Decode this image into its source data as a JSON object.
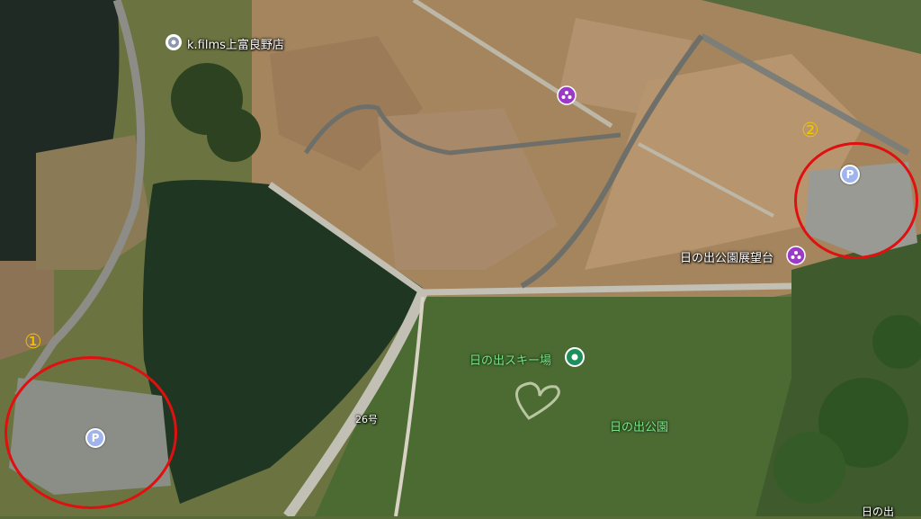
{
  "places": {
    "kfilms": {
      "name": "k.films上富良野店",
      "icon": "location-pin-icon"
    },
    "viewpoint_top": {
      "icon": "viewpoint-icon",
      "color": "#9b39c8"
    },
    "observatory": {
      "name": "日の出公園展望台",
      "icon": "viewpoint-icon",
      "color": "#9b39c8"
    },
    "ski": {
      "name": "日の出スキー場",
      "icon": "ski-pin-icon",
      "color": "#1e8e5a"
    },
    "park": {
      "name": "日の出公園"
    },
    "route": {
      "name": "26号"
    },
    "bottom_right": {
      "name": "日の出"
    }
  },
  "parking": [
    {
      "glyph": "P",
      "icon": "parking-icon",
      "color": "#9fb3ec"
    },
    {
      "glyph": "P",
      "icon": "parking-icon",
      "color": "#9fb3ec"
    }
  ],
  "markers": [
    {
      "number": "①",
      "color": "#f2c400"
    },
    {
      "number": "②",
      "color": "#f2c400"
    }
  ],
  "highlight_color": "#e01010"
}
